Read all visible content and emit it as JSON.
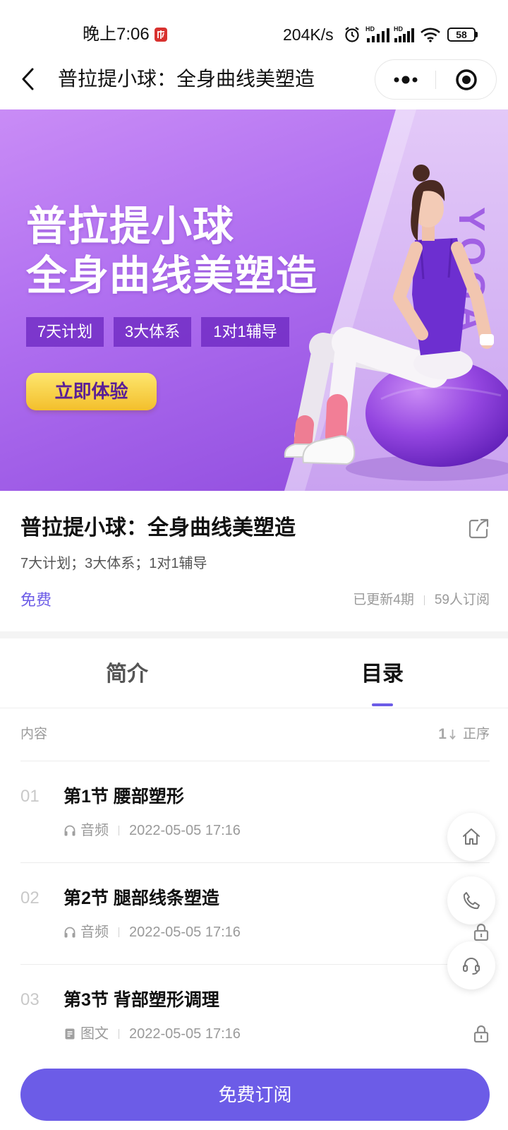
{
  "status_bar": {
    "time": "晚上7:06",
    "net_speed": "204K/s",
    "signal_label": "HD",
    "battery": "58"
  },
  "nav": {
    "title": "普拉提小球：全身曲线美塑造"
  },
  "banner": {
    "title_line1": "普拉提小球",
    "title_line2": "全身曲线美塑造",
    "tags": [
      "7天计划",
      "3大体系",
      "1对1辅导"
    ],
    "cta": "立即体验",
    "vertical_text": "YOGA"
  },
  "course": {
    "title": "普拉提小球：全身曲线美塑造",
    "subtitle": "7大计划；3大体系；1对1辅导",
    "price": "免费",
    "updated": "已更新4期",
    "subscribers": "59人订阅"
  },
  "tabs": [
    {
      "label": "简介",
      "active": false
    },
    {
      "label": "目录",
      "active": true
    }
  ],
  "catalog": {
    "header": "内容",
    "sort_number": "1",
    "sort_label": "正序",
    "items": [
      {
        "num": "01",
        "title": "第1节 腰部塑形",
        "type": "音频",
        "type_icon": "headphones-icon",
        "date": "2022-05-05 17:16",
        "locked": false
      },
      {
        "num": "02",
        "title": "第2节 腿部线条塑造",
        "type": "音频",
        "type_icon": "headphones-icon",
        "date": "2022-05-05 17:16",
        "locked": true
      },
      {
        "num": "03",
        "title": "第3节 背部塑形调理",
        "type": "图文",
        "type_icon": "document-icon",
        "date": "2022-05-05 17:16",
        "locked": true
      }
    ]
  },
  "floating_buttons": [
    {
      "icon": "home-icon"
    },
    {
      "icon": "phone-icon"
    },
    {
      "icon": "headset-icon"
    }
  ],
  "subscribe_button": "免费订阅",
  "colors": {
    "accent": "#6c5ce7",
    "banner_purple": "#b06ff0",
    "cta_yellow": "#f6c83a"
  }
}
